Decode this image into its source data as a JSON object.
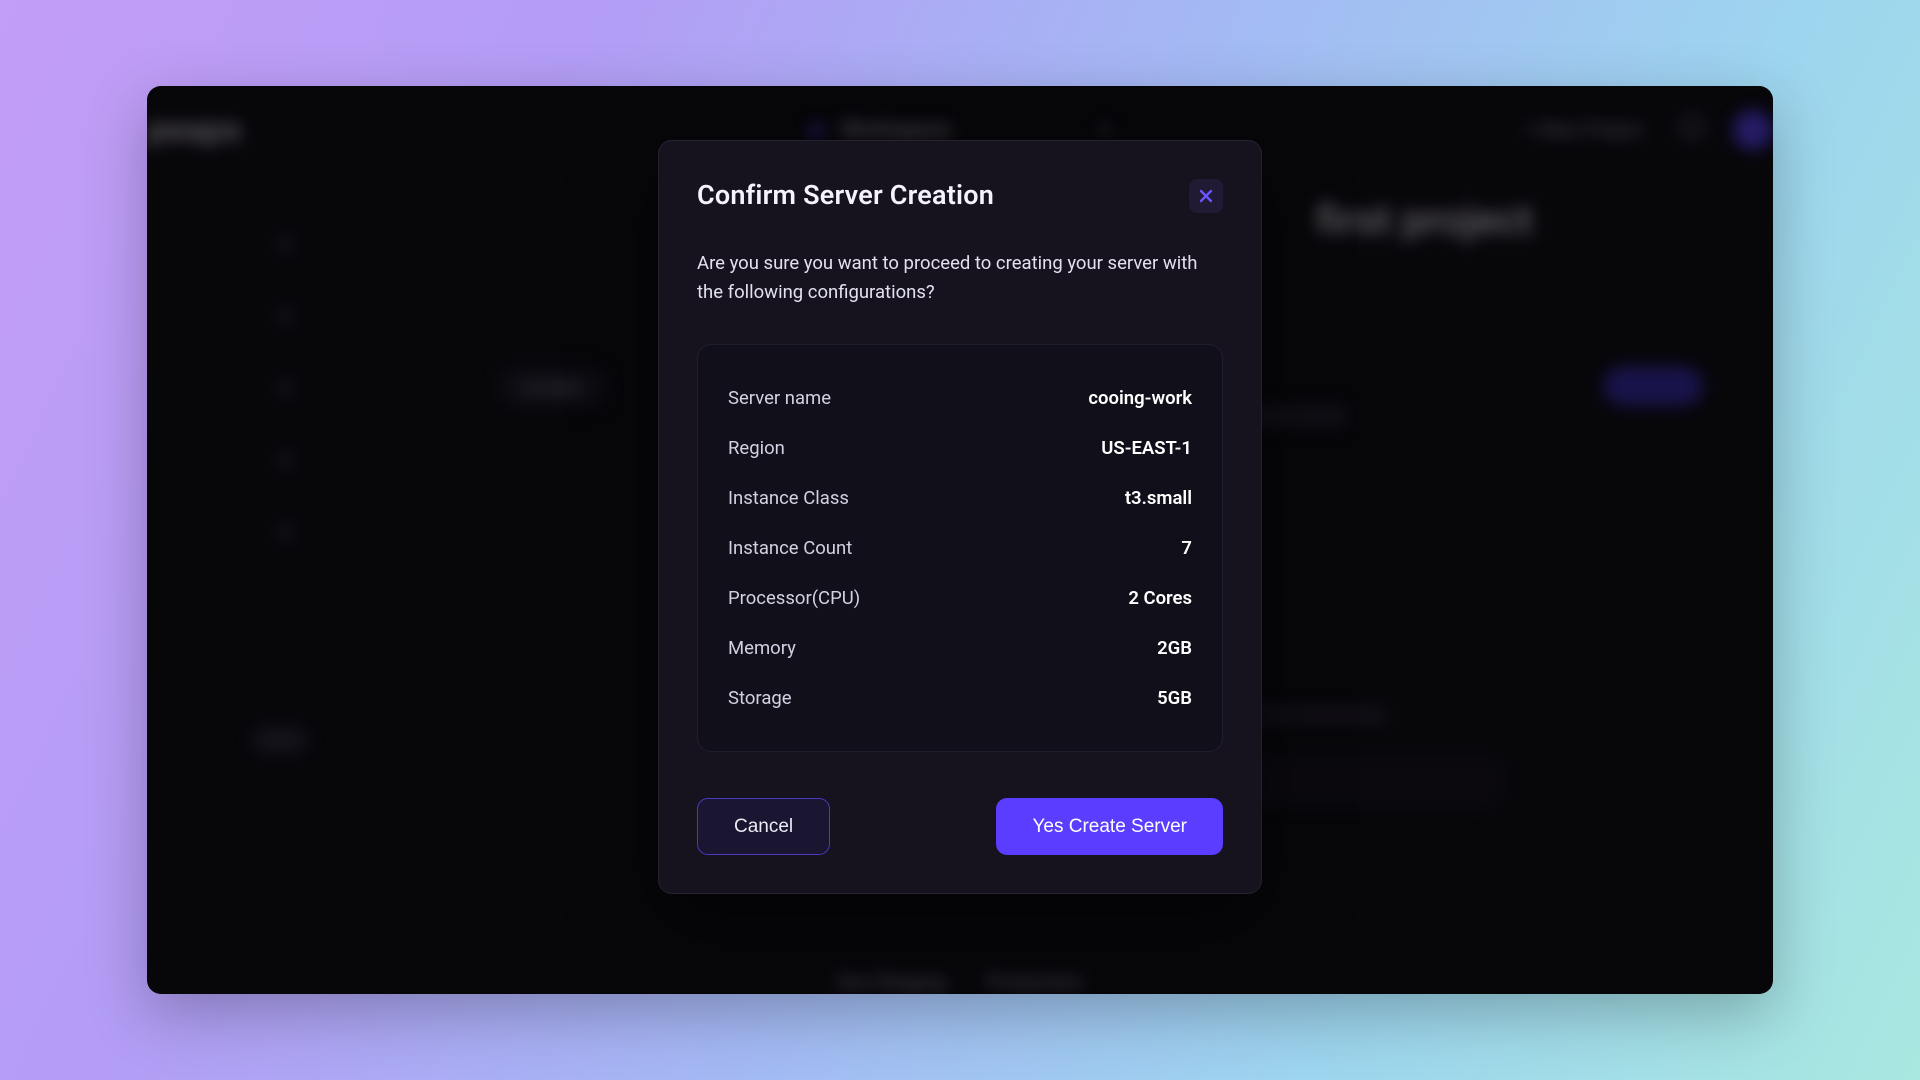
{
  "background": {
    "brand": "peaps",
    "workspace_label": "Workspace",
    "new_project_label": "+  New Project",
    "page_heading": "first project",
    "back_label": "Go Back",
    "tabs": {
      "left": "Dev/Staging",
      "right": "Production"
    }
  },
  "modal": {
    "title": "Confirm Server Creation",
    "question": "Are you sure you want to proceed to creating your server with the following configurations?",
    "fields": {
      "server_name": {
        "label": "Server name",
        "value": "cooing-work"
      },
      "region": {
        "label": "Region",
        "value": "US-EAST-1"
      },
      "instance_class": {
        "label": "Instance Class",
        "value": "t3.small"
      },
      "instance_count": {
        "label": "Instance Count",
        "value": "7"
      },
      "processor": {
        "label": "Processor(CPU)",
        "value": "2 Cores"
      },
      "memory": {
        "label": "Memory",
        "value": "2GB"
      },
      "storage": {
        "label": "Storage",
        "value": "5GB"
      }
    },
    "buttons": {
      "cancel": "Cancel",
      "confirm": "Yes Create Server"
    }
  }
}
